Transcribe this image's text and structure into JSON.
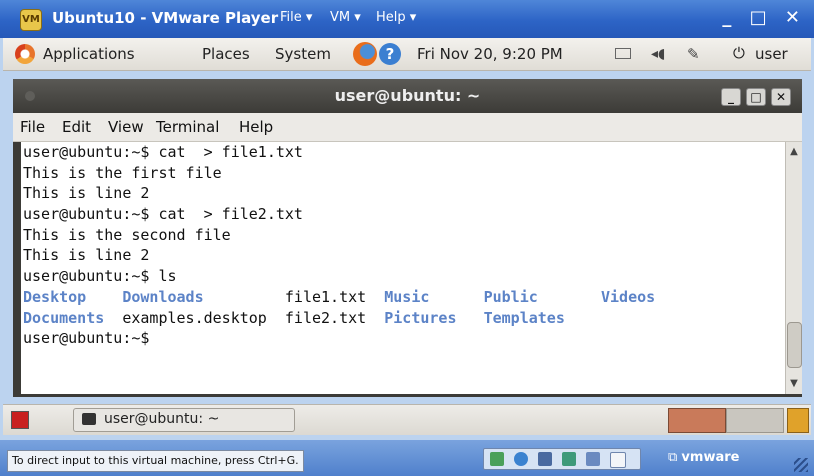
{
  "vmware": {
    "logo_text": "VM",
    "title": "Ubuntu10 - VMware Player",
    "menus": [
      "File ▾",
      "VM ▾",
      "Help ▾"
    ],
    "window_buttons": "_ □ ✕"
  },
  "gnome_panel": {
    "applications": "Applications",
    "places": "Places",
    "system": "System",
    "clock": "Fri Nov 20,  9:20 PM",
    "user": "user"
  },
  "terminal": {
    "title": "user@ubuntu: ~",
    "buttons": [
      "_",
      "□",
      "✕"
    ],
    "menu": [
      "File",
      "Edit",
      "View",
      "Terminal",
      "Help"
    ],
    "lines": [
      "user@ubuntu:~$ cat  > file1.txt",
      "This is the first file",
      "This is line 2",
      "user@ubuntu:~$ cat  > file2.txt",
      "This is the second file",
      "This is line 2",
      "user@ubuntu:~$ ls"
    ],
    "ls_row1": [
      "Desktop",
      "Downloads",
      "file1.txt",
      "Music",
      "Public",
      "Videos"
    ],
    "ls_row2": [
      "Documents",
      "examples.desktop",
      "file2.txt",
      "Pictures",
      "Templates"
    ],
    "prompt": "user@ubuntu:~$"
  },
  "bottom_panel": {
    "task_label": "user@ubuntu: ~"
  },
  "status_bar": {
    "message": "To direct input to this virtual machine, press Ctrl+G.",
    "brand": "vmware"
  }
}
